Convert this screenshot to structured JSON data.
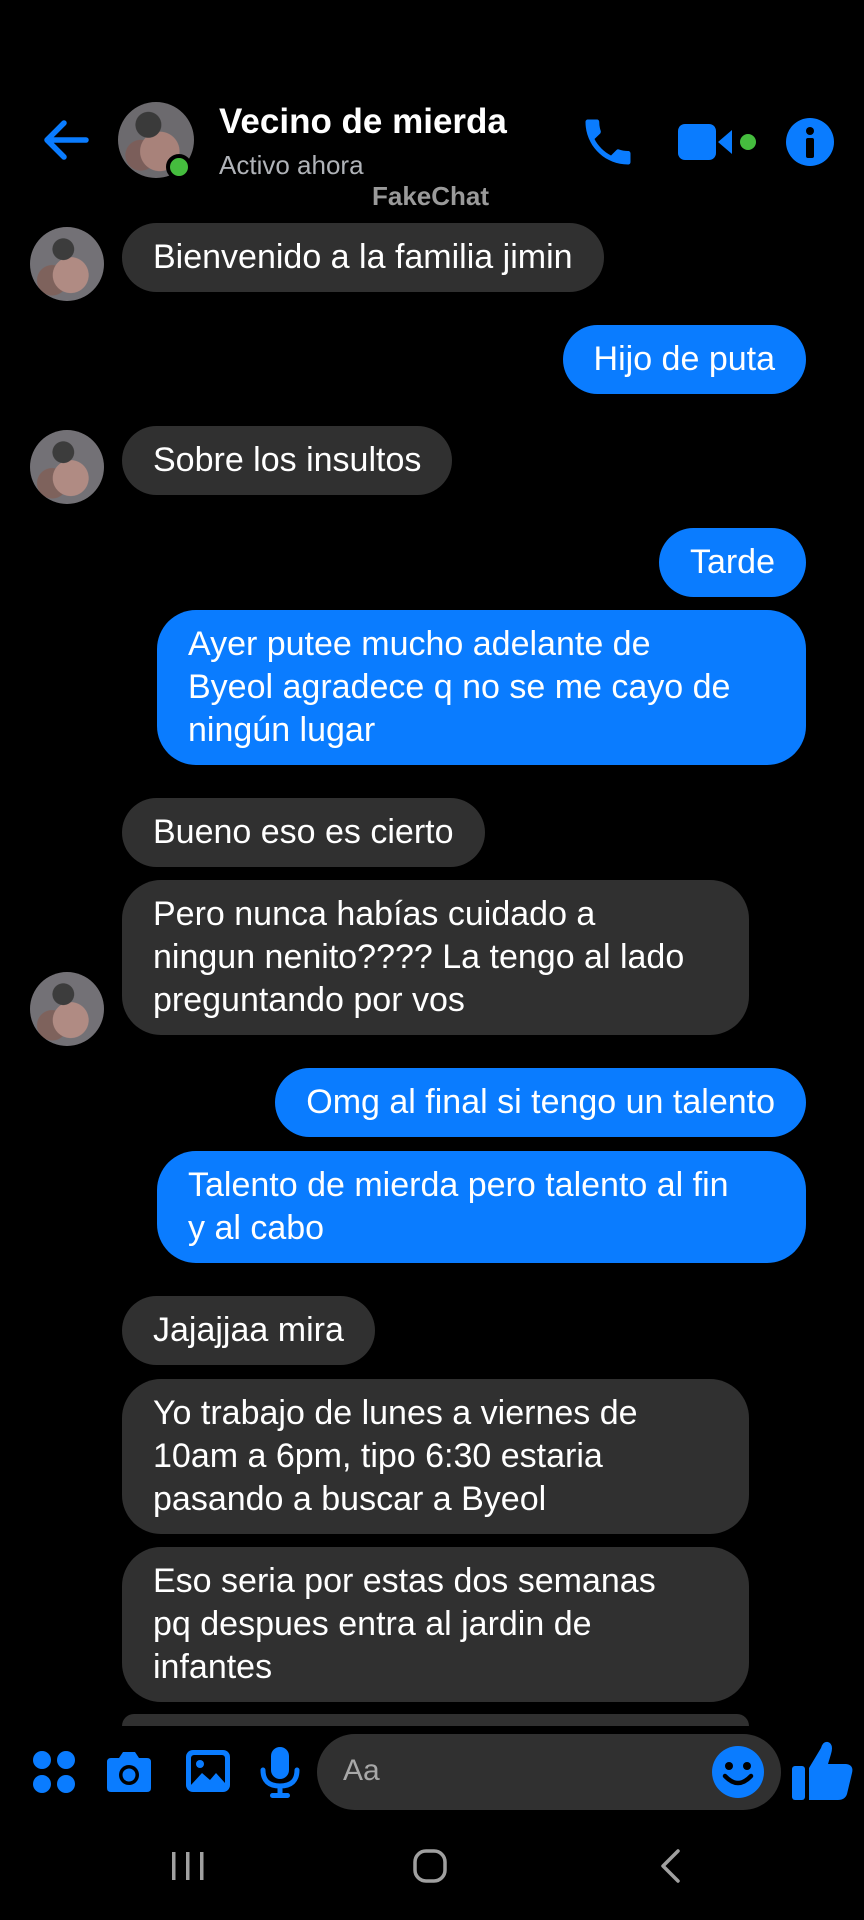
{
  "header": {
    "contact_name": "Vecino de mierda",
    "status": "Activo ahora",
    "watermark": "FakeChat",
    "icons": [
      "back-arrow-icon",
      "phone-icon",
      "video-camera-icon",
      "info-icon"
    ],
    "accent_color": "#0a7cff",
    "online_color": "#45bd3e"
  },
  "messages": [
    {
      "from": "contact",
      "text": "Bienvenido a la familia jimin"
    },
    {
      "from": "me",
      "text": "Hijo de puta"
    },
    {
      "from": "contact",
      "text": "Sobre los insultos"
    },
    {
      "from": "me",
      "text": "Tarde"
    },
    {
      "from": "me",
      "text": "Ayer putee mucho adelante de\nByeol agradece q no se me cayo de\nningún lugar"
    },
    {
      "from": "contact",
      "text": "Bueno eso es cierto"
    },
    {
      "from": "contact",
      "text": "Pero nunca habías cuidado a\nningun nenito???? La tengo al lado\npreguntando por vos"
    },
    {
      "from": "me",
      "text": "Omg al final si tengo un talento"
    },
    {
      "from": "me",
      "text": "Talento de mierda pero talento al fin\ny al cabo"
    },
    {
      "from": "contact",
      "text": "Jajajjaa mira"
    },
    {
      "from": "contact",
      "text": "Yo trabajo de lunes a viernes de\n10am a 6pm, tipo 6:30 estaria\npasando a buscar a Byeol"
    },
    {
      "from": "contact",
      "text": "Eso seria por estas dos semanas\npq despues entra al jardin de\ninfantes"
    }
  ],
  "composer": {
    "placeholder": "Aa",
    "icons": [
      "apps-icon",
      "camera-icon",
      "gallery-icon",
      "microphone-icon",
      "emoji-icon",
      "thumbs-up-icon"
    ]
  },
  "colors": {
    "incoming_bubble": "#303030",
    "outgoing_bubble": "#0a7cff",
    "background": "#000000"
  }
}
